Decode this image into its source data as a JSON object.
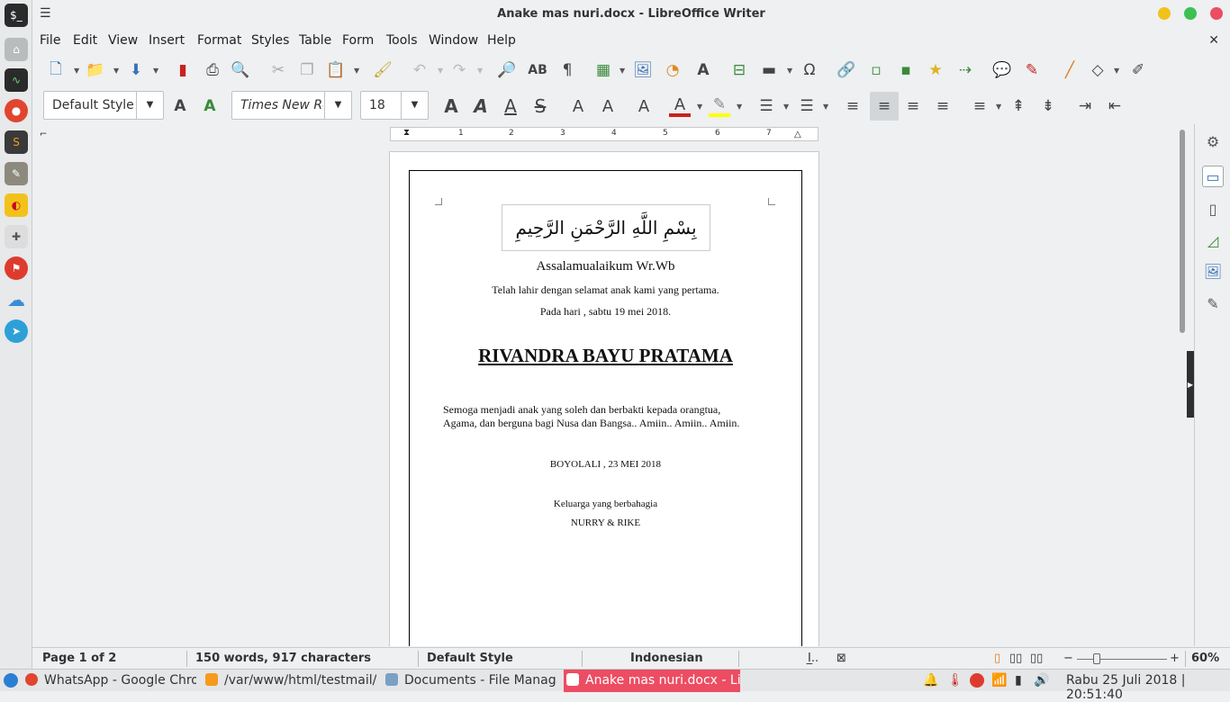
{
  "window": {
    "title": "Anake mas nuri.docx - LibreOffice Writer"
  },
  "menu": [
    "File",
    "Edit",
    "View",
    "Insert",
    "Format",
    "Styles",
    "Table",
    "Form",
    "Tools",
    "Window",
    "Help"
  ],
  "formatting": {
    "paragraph_style": "Default Style",
    "font_name": "Times New Roman",
    "font_size": "18"
  },
  "ruler": {
    "labels": [
      "1",
      "2",
      "3",
      "4",
      "5",
      "6",
      "7"
    ]
  },
  "document": {
    "basmalah": "بِسْمِ اللَّهِ الرَّحْمَنِ الرَّحِيمِ",
    "greeting": "Assalamualaikum Wr.Wb",
    "line1": "Telah lahir dengan selamat anak kami yang pertama.",
    "line2": "Pada hari , sabtu 19 mei 2018.",
    "name": "RIVANDRA BAYU PRATAMA",
    "wish1": "Semoga menjadi anak yang soleh dan berbakti kepada orangtua,",
    "wish2": "Agama, dan berguna bagi Nusa dan Bangsa.. Amiin.. Amiin.. Amiin.",
    "place_date": "BOYOLALI , 23 MEI 2018",
    "family_label": "Keluarga yang berbahagia",
    "family_names": "NURRY & RIKE"
  },
  "status": {
    "page": "Page 1 of 2",
    "words": "150 words, 917 characters",
    "style": "Default Style",
    "language": "Indonesian",
    "zoom": "60%"
  },
  "taskbar": {
    "items": [
      "WhatsApp - Google Chro...",
      "/var/www/html/testmail/...",
      "Documents - File Manager",
      "Anake mas nuri.docx - Lib..."
    ],
    "clock": "Rabu 25 Juli 2018 | 20:51:40"
  },
  "colors": {
    "accent_task": "#ec4d63",
    "font_color": "#c9211e",
    "highlight": "#ffff00"
  }
}
